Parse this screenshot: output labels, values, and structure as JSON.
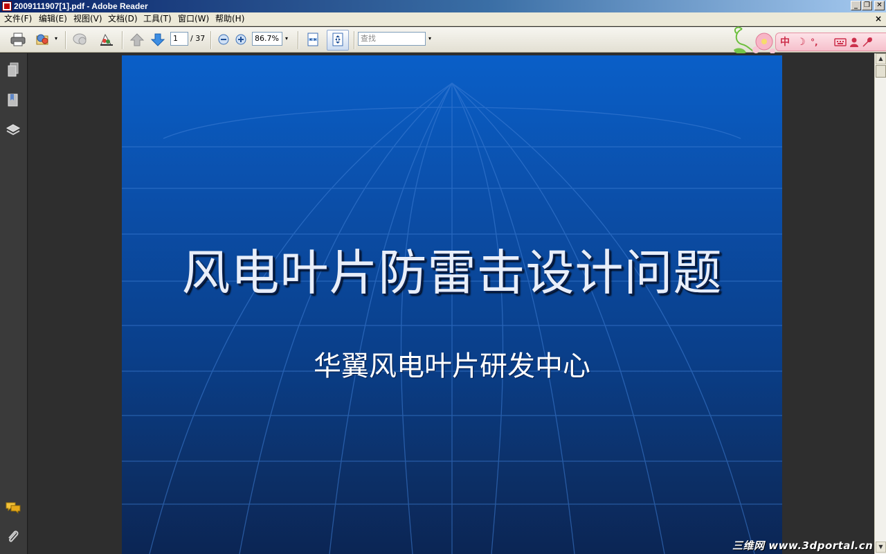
{
  "window": {
    "title": "2009111907[1].pdf - Adobe Reader"
  },
  "menus": [
    "文件(F)",
    "编辑(E)",
    "视图(V)",
    "文档(D)",
    "工具(T)",
    "窗口(W)",
    "帮助(H)"
  ],
  "window_controls": {
    "minimize": "_",
    "restore": "❐",
    "close": "✕",
    "doc_close": "×"
  },
  "toolbar": {
    "page_current": "1",
    "page_total": "/ 37",
    "zoom": "86.7%",
    "search_placeholder": "查找"
  },
  "ime": {
    "mode": "中",
    "moon": "☽",
    "punct": "°,"
  },
  "slide": {
    "title": "风电叶片防雷击设计问题",
    "subtitle": "华翼风电叶片研发中心"
  },
  "watermark": "三维网 www.3dportal.cn",
  "colors": {
    "titlebar_start": "#0a246a",
    "slide_top": "#0a5fc8",
    "slide_bottom": "#0b2554",
    "ime_accent": "#cc2f4b"
  }
}
